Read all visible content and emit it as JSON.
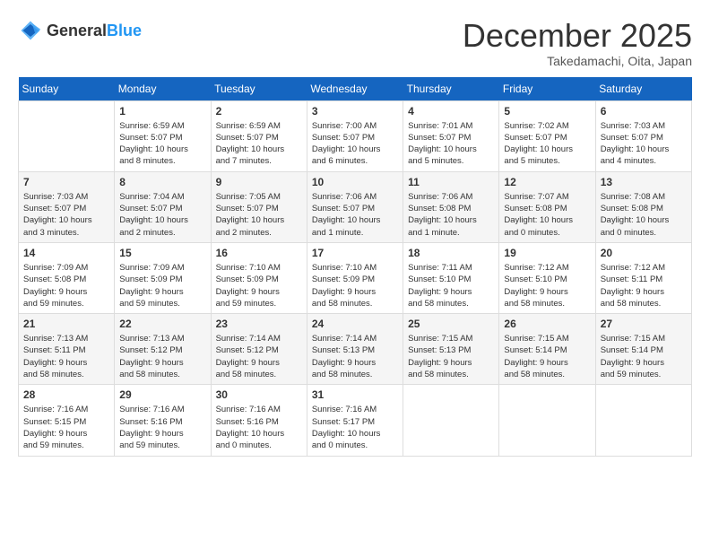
{
  "header": {
    "logo_general": "General",
    "logo_blue": "Blue",
    "month_title": "December 2025",
    "location": "Takedamachi, Oita, Japan"
  },
  "days_of_week": [
    "Sunday",
    "Monday",
    "Tuesday",
    "Wednesday",
    "Thursday",
    "Friday",
    "Saturday"
  ],
  "weeks": [
    [
      {
        "day": "",
        "info": ""
      },
      {
        "day": "1",
        "info": "Sunrise: 6:59 AM\nSunset: 5:07 PM\nDaylight: 10 hours\nand 8 minutes."
      },
      {
        "day": "2",
        "info": "Sunrise: 6:59 AM\nSunset: 5:07 PM\nDaylight: 10 hours\nand 7 minutes."
      },
      {
        "day": "3",
        "info": "Sunrise: 7:00 AM\nSunset: 5:07 PM\nDaylight: 10 hours\nand 6 minutes."
      },
      {
        "day": "4",
        "info": "Sunrise: 7:01 AM\nSunset: 5:07 PM\nDaylight: 10 hours\nand 5 minutes."
      },
      {
        "day": "5",
        "info": "Sunrise: 7:02 AM\nSunset: 5:07 PM\nDaylight: 10 hours\nand 5 minutes."
      },
      {
        "day": "6",
        "info": "Sunrise: 7:03 AM\nSunset: 5:07 PM\nDaylight: 10 hours\nand 4 minutes."
      }
    ],
    [
      {
        "day": "7",
        "info": "Sunrise: 7:03 AM\nSunset: 5:07 PM\nDaylight: 10 hours\nand 3 minutes."
      },
      {
        "day": "8",
        "info": "Sunrise: 7:04 AM\nSunset: 5:07 PM\nDaylight: 10 hours\nand 2 minutes."
      },
      {
        "day": "9",
        "info": "Sunrise: 7:05 AM\nSunset: 5:07 PM\nDaylight: 10 hours\nand 2 minutes."
      },
      {
        "day": "10",
        "info": "Sunrise: 7:06 AM\nSunset: 5:07 PM\nDaylight: 10 hours\nand 1 minute."
      },
      {
        "day": "11",
        "info": "Sunrise: 7:06 AM\nSunset: 5:08 PM\nDaylight: 10 hours\nand 1 minute."
      },
      {
        "day": "12",
        "info": "Sunrise: 7:07 AM\nSunset: 5:08 PM\nDaylight: 10 hours\nand 0 minutes."
      },
      {
        "day": "13",
        "info": "Sunrise: 7:08 AM\nSunset: 5:08 PM\nDaylight: 10 hours\nand 0 minutes."
      }
    ],
    [
      {
        "day": "14",
        "info": "Sunrise: 7:09 AM\nSunset: 5:08 PM\nDaylight: 9 hours\nand 59 minutes."
      },
      {
        "day": "15",
        "info": "Sunrise: 7:09 AM\nSunset: 5:09 PM\nDaylight: 9 hours\nand 59 minutes."
      },
      {
        "day": "16",
        "info": "Sunrise: 7:10 AM\nSunset: 5:09 PM\nDaylight: 9 hours\nand 59 minutes."
      },
      {
        "day": "17",
        "info": "Sunrise: 7:10 AM\nSunset: 5:09 PM\nDaylight: 9 hours\nand 58 minutes."
      },
      {
        "day": "18",
        "info": "Sunrise: 7:11 AM\nSunset: 5:10 PM\nDaylight: 9 hours\nand 58 minutes."
      },
      {
        "day": "19",
        "info": "Sunrise: 7:12 AM\nSunset: 5:10 PM\nDaylight: 9 hours\nand 58 minutes."
      },
      {
        "day": "20",
        "info": "Sunrise: 7:12 AM\nSunset: 5:11 PM\nDaylight: 9 hours\nand 58 minutes."
      }
    ],
    [
      {
        "day": "21",
        "info": "Sunrise: 7:13 AM\nSunset: 5:11 PM\nDaylight: 9 hours\nand 58 minutes."
      },
      {
        "day": "22",
        "info": "Sunrise: 7:13 AM\nSunset: 5:12 PM\nDaylight: 9 hours\nand 58 minutes."
      },
      {
        "day": "23",
        "info": "Sunrise: 7:14 AM\nSunset: 5:12 PM\nDaylight: 9 hours\nand 58 minutes."
      },
      {
        "day": "24",
        "info": "Sunrise: 7:14 AM\nSunset: 5:13 PM\nDaylight: 9 hours\nand 58 minutes."
      },
      {
        "day": "25",
        "info": "Sunrise: 7:15 AM\nSunset: 5:13 PM\nDaylight: 9 hours\nand 58 minutes."
      },
      {
        "day": "26",
        "info": "Sunrise: 7:15 AM\nSunset: 5:14 PM\nDaylight: 9 hours\nand 58 minutes."
      },
      {
        "day": "27",
        "info": "Sunrise: 7:15 AM\nSunset: 5:14 PM\nDaylight: 9 hours\nand 59 minutes."
      }
    ],
    [
      {
        "day": "28",
        "info": "Sunrise: 7:16 AM\nSunset: 5:15 PM\nDaylight: 9 hours\nand 59 minutes."
      },
      {
        "day": "29",
        "info": "Sunrise: 7:16 AM\nSunset: 5:16 PM\nDaylight: 9 hours\nand 59 minutes."
      },
      {
        "day": "30",
        "info": "Sunrise: 7:16 AM\nSunset: 5:16 PM\nDaylight: 10 hours\nand 0 minutes."
      },
      {
        "day": "31",
        "info": "Sunrise: 7:16 AM\nSunset: 5:17 PM\nDaylight: 10 hours\nand 0 minutes."
      },
      {
        "day": "",
        "info": ""
      },
      {
        "day": "",
        "info": ""
      },
      {
        "day": "",
        "info": ""
      }
    ]
  ]
}
